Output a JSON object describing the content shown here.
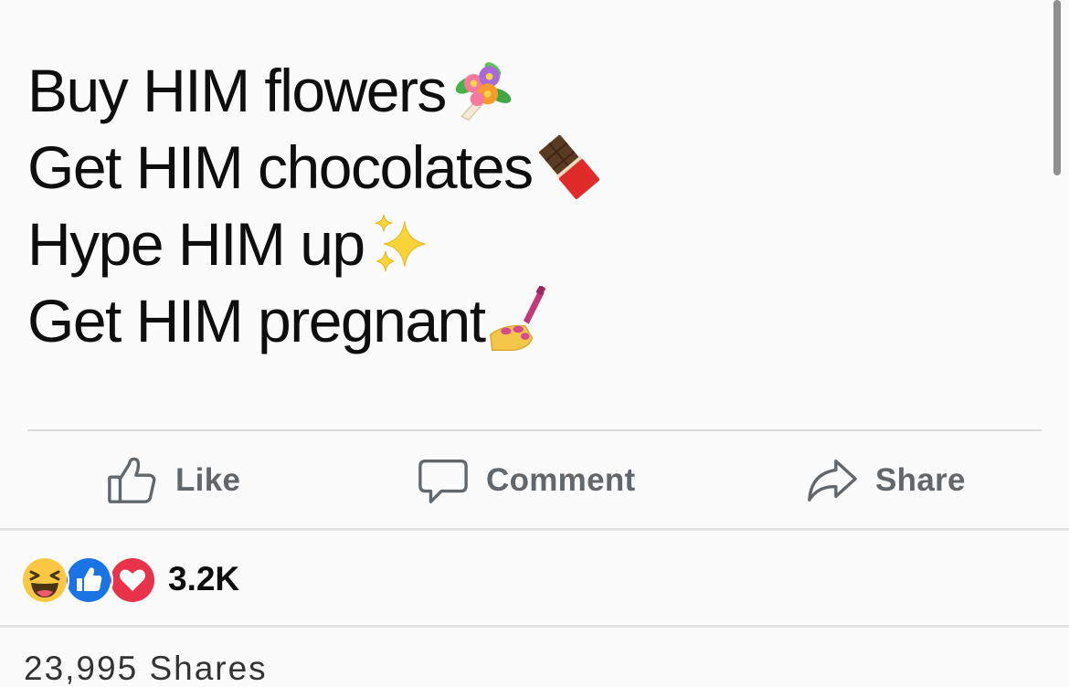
{
  "post": {
    "lines": [
      {
        "text": "Buy HIM flowers",
        "emoji": "bouquet-emoji"
      },
      {
        "text": "Get HIM chocolates",
        "emoji": "chocolate-bar-emoji"
      },
      {
        "text": "Hype HIM up",
        "emoji": "sparkles-emoji"
      },
      {
        "text": "Get HIM pregnant",
        "emoji": "nail-polish-emoji"
      }
    ]
  },
  "actions": {
    "like_label": "Like",
    "comment_label": "Comment",
    "share_label": "Share"
  },
  "reactions": {
    "icons": [
      "haha-reaction-icon",
      "like-reaction-icon",
      "love-reaction-icon"
    ],
    "count": "3.2K"
  },
  "shares": {
    "text": "23,995 Shares"
  },
  "colors": {
    "action_text": "#62676c",
    "like_blue": "#1b74e4",
    "love_red": "#e8334a",
    "haha_yellow": "#fcc844"
  }
}
